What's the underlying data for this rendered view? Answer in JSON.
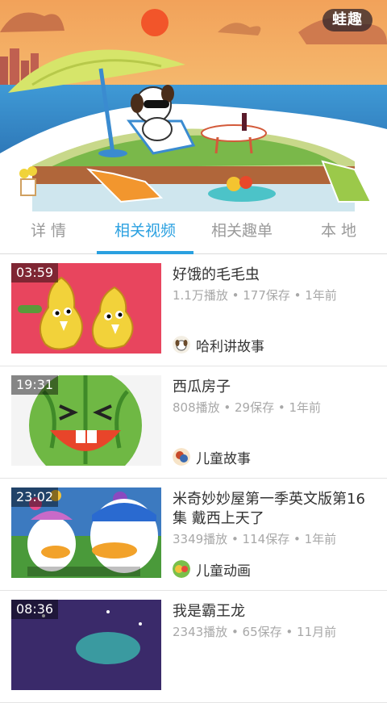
{
  "app": {
    "logo_text": "蛙趣",
    "accent_color": "#2aa0e0"
  },
  "tabs": [
    {
      "label": "详 情",
      "active": false
    },
    {
      "label": "相关视频",
      "active": true
    },
    {
      "label": "相关趣单",
      "active": false
    },
    {
      "label": "本 地",
      "active": false
    }
  ],
  "videos": [
    {
      "duration": "03:59",
      "title": "好饿的毛毛虫",
      "meta": "1.1万播放 • 177保存 • 1年前",
      "author": "哈利讲故事"
    },
    {
      "duration": "19:31",
      "title": "西瓜房子",
      "meta": "808播放 • 29保存 • 1年前",
      "author": "儿童故事"
    },
    {
      "duration": "23:02",
      "title": "米奇妙妙屋第一季英文版第16集 戴西上天了",
      "meta": "3349播放 • 114保存 • 1年前",
      "author": "儿童动画"
    },
    {
      "duration": "08:36",
      "title": "我是霸王龙",
      "meta": "2343播放 • 65保存 • 11月前",
      "author": ""
    }
  ]
}
